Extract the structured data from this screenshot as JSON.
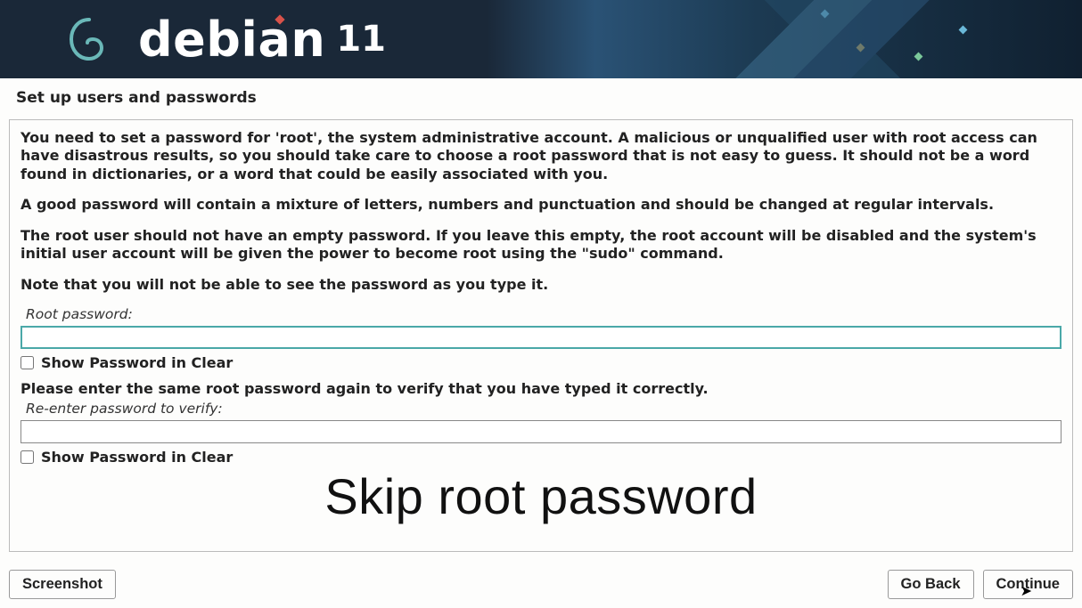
{
  "header": {
    "brand": "debian",
    "version": "11"
  },
  "page_title": "Set up users and passwords",
  "paragraphs": {
    "p1": "You need to set a password for 'root', the system administrative account. A malicious or unqualified user with root access can have disastrous results, so you should take care to choose a root password that is not easy to guess. It should not be a word found in dictionaries, or a word that could be easily associated with you.",
    "p2": "A good password will contain a mixture of letters, numbers and punctuation and should be changed at regular intervals.",
    "p3": "The root user should not have an empty password. If you leave this empty, the root account will be disabled and the system's initial user account will be given the power to become root using the \"sudo\" command.",
    "p4": "Note that you will not be able to see the password as you type it."
  },
  "fields": {
    "root_password_label": "Root password:",
    "root_password_value": "",
    "show_password_1_label": "Show Password in Clear",
    "verify_instruction": "Please enter the same root password again to verify that you have typed it correctly.",
    "verify_label": "Re-enter password to verify:",
    "verify_value": "",
    "show_password_2_label": "Show Password in Clear"
  },
  "overlay_caption": "Skip root password",
  "buttons": {
    "screenshot": "Screenshot",
    "go_back": "Go Back",
    "continue": "Continue"
  }
}
